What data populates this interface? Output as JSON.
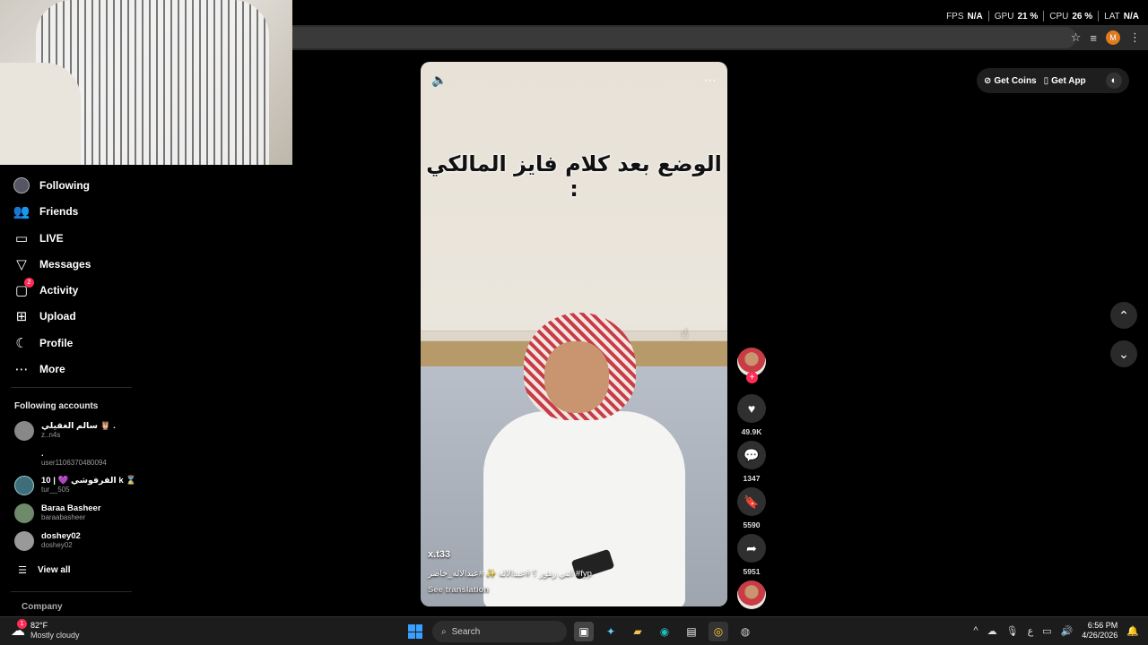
{
  "stats": {
    "fps_label": "FPS",
    "fps_value": "N/A",
    "gpu_label": "GPU",
    "gpu_value": "21 %",
    "cpu_label": "CPU",
    "cpu_value": "26 %",
    "lat_label": "LAT",
    "lat_value": "N/A"
  },
  "browser": {
    "profile_initial": "M"
  },
  "sidebar": {
    "nav": [
      {
        "label": "Following",
        "icon": "following-icon"
      },
      {
        "label": "Friends",
        "icon": "friends-icon"
      },
      {
        "label": "LIVE",
        "icon": "live-icon"
      },
      {
        "label": "Messages",
        "icon": "messages-icon"
      },
      {
        "label": "Activity",
        "icon": "activity-icon",
        "badge": "2"
      },
      {
        "label": "Upload",
        "icon": "upload-icon"
      },
      {
        "label": "Profile",
        "icon": "profile-icon"
      },
      {
        "label": "More",
        "icon": "more-icon"
      }
    ],
    "following_title": "Following accounts",
    "accounts": [
      {
        "name": "سالم الغفيلي 🦉 .",
        "username": "z..n4s"
      },
      {
        "name": ".",
        "username": "user1106370480094"
      },
      {
        "name": "10 | 💜 الفرفوشي k ⌛",
        "username": "tur__505"
      },
      {
        "name": "Baraa Basheer",
        "username": "baraabasheer"
      },
      {
        "name": "doshey02",
        "username": "doshey02"
      }
    ],
    "view_all": "View all",
    "company": "Company"
  },
  "video": {
    "overlay_text": "الوضع بعد كلام فايز المالكي :",
    "author": "x.t33",
    "description": "انتي زهور ؟ #عبدالاله ✨ #عبدالاله_حاضر #fyp",
    "translate": "See translation"
  },
  "actions": {
    "likes": "49.9K",
    "comments": "1347",
    "saves": "5590",
    "shares": "5951"
  },
  "top_right": {
    "get_coins": "Get Coins",
    "get_app": "Get App"
  },
  "taskbar": {
    "temp": "82°F",
    "condition": "Mostly cloudy",
    "weather_badge": "1",
    "search_placeholder": "Search",
    "time": "6:56 PM",
    "date": "4/26/2026"
  }
}
